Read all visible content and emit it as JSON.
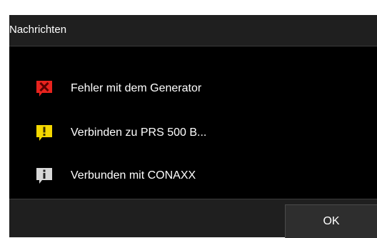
{
  "dialog": {
    "title": "Nachrichten",
    "messages": [
      {
        "type": "error",
        "icon": "error-icon",
        "color": "#e8231e",
        "text": "Fehler mit dem Generator"
      },
      {
        "type": "warning",
        "icon": "warning-icon",
        "color": "#f5d800",
        "text": "Verbinden zu PRS 500 B..."
      },
      {
        "type": "info",
        "icon": "info-icon",
        "color": "#d8d8d8",
        "text": "Verbunden mit CONAXX"
      }
    ],
    "ok_label": "OK"
  }
}
